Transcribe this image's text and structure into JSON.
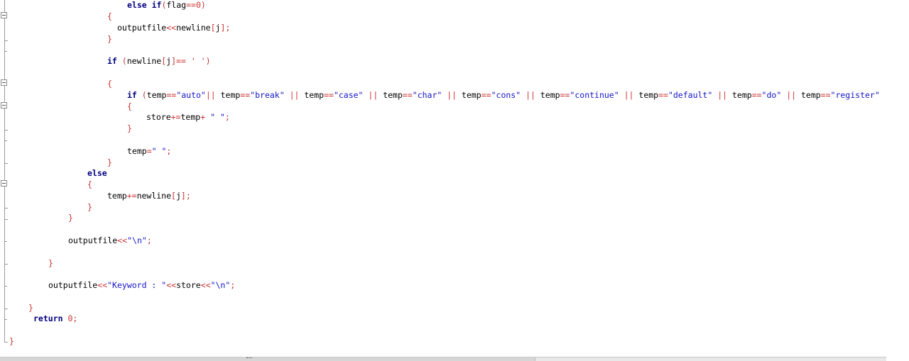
{
  "editor": {
    "colors": {
      "keyword": "#000080",
      "identifier": "#000000",
      "operator": "#cc3333",
      "string": "#1515c8",
      "background": "#ffffff"
    },
    "lines": [
      [
        [
          "kw",
          "else if"
        ],
        [
          "op",
          "("
        ],
        [
          "id",
          "flag"
        ],
        [
          "op",
          "=="
        ],
        [
          "num",
          "0"
        ],
        [
          "op",
          ")"
        ]
      ],
      [
        [
          "op",
          "{"
        ]
      ],
      [
        [
          "id",
          "outputfile"
        ],
        [
          "op",
          "<<"
        ],
        [
          "id",
          "newline"
        ],
        [
          "op",
          "["
        ],
        [
          "id",
          "j"
        ],
        [
          "op",
          "];"
        ]
      ],
      [
        [
          "op",
          "}"
        ]
      ],
      [
        [
          "kw",
          "if"
        ],
        [
          "id",
          " "
        ],
        [
          "op",
          "("
        ],
        [
          "id",
          "newline"
        ],
        [
          "op",
          "["
        ],
        [
          "id",
          "j"
        ],
        [
          "op",
          "]=="
        ],
        [
          "id",
          " "
        ],
        [
          "ch",
          "' '"
        ],
        [
          "op",
          ")"
        ]
      ],
      [
        [
          "op",
          "{"
        ]
      ],
      [
        [
          "kw",
          "if"
        ],
        [
          "id",
          " "
        ],
        [
          "op",
          "("
        ],
        [
          "id",
          "temp"
        ],
        [
          "op",
          "=="
        ],
        [
          "str",
          "\"auto\""
        ],
        [
          "op",
          "||"
        ],
        [
          "id",
          " temp"
        ],
        [
          "op",
          "=="
        ],
        [
          "str",
          "\"break\""
        ],
        [
          "id",
          " "
        ],
        [
          "op",
          "||"
        ],
        [
          "id",
          " temp"
        ],
        [
          "op",
          "=="
        ],
        [
          "str",
          "\"case\""
        ],
        [
          "id",
          " "
        ],
        [
          "op",
          "||"
        ],
        [
          "id",
          " temp"
        ],
        [
          "op",
          "=="
        ],
        [
          "str",
          "\"char\""
        ],
        [
          "id",
          " "
        ],
        [
          "op",
          "||"
        ],
        [
          "id",
          " temp"
        ],
        [
          "op",
          "=="
        ],
        [
          "str",
          "\"cons\""
        ],
        [
          "id",
          " "
        ],
        [
          "op",
          "||"
        ],
        [
          "id",
          " temp"
        ],
        [
          "op",
          "=="
        ],
        [
          "str",
          "\"continue\""
        ],
        [
          "id",
          " "
        ],
        [
          "op",
          "||"
        ],
        [
          "id",
          " temp"
        ],
        [
          "op",
          "=="
        ],
        [
          "str",
          "\"default\""
        ],
        [
          "id",
          " "
        ],
        [
          "op",
          "||"
        ],
        [
          "id",
          " temp"
        ],
        [
          "op",
          "=="
        ],
        [
          "str",
          "\"do\""
        ],
        [
          "id",
          " "
        ],
        [
          "op",
          "||"
        ],
        [
          "id",
          " temp"
        ],
        [
          "op",
          "=="
        ],
        [
          "str",
          "\"register\""
        ]
      ],
      [
        [
          "op",
          "{"
        ]
      ],
      [
        [
          "id",
          "store"
        ],
        [
          "op",
          "+="
        ],
        [
          "id",
          "temp"
        ],
        [
          "op",
          "+"
        ],
        [
          "id",
          " "
        ],
        [
          "str",
          "\" \""
        ],
        [
          "op",
          ";"
        ]
      ],
      [
        [
          "op",
          "}"
        ]
      ],
      [
        [
          "id",
          "temp"
        ],
        [
          "op",
          "="
        ],
        [
          "str",
          "\" \""
        ],
        [
          "op",
          ";"
        ]
      ],
      [
        [
          "op",
          "}"
        ]
      ],
      [
        [
          "kw",
          "else"
        ]
      ],
      [
        [
          "op",
          "{"
        ]
      ],
      [
        [
          "id",
          "temp"
        ],
        [
          "op",
          "+="
        ],
        [
          "id",
          "newline"
        ],
        [
          "op",
          "["
        ],
        [
          "id",
          "j"
        ],
        [
          "op",
          "];"
        ]
      ],
      [
        [
          "op",
          "}"
        ]
      ],
      [
        [
          "op",
          "}"
        ]
      ],
      [
        [
          "id",
          "outputfile"
        ],
        [
          "op",
          "<<"
        ],
        [
          "str",
          "\"\\n\""
        ],
        [
          "op",
          ";"
        ]
      ],
      [
        [
          "op",
          "}"
        ]
      ],
      [
        [
          "id",
          "outputfile"
        ],
        [
          "op",
          "<<"
        ],
        [
          "str",
          "\"Keyword : \""
        ],
        [
          "op",
          "<<"
        ],
        [
          "id",
          "store"
        ],
        [
          "op",
          "<<"
        ],
        [
          "str",
          "\"\\n\""
        ],
        [
          "op",
          ";"
        ]
      ],
      [
        [
          "op",
          "}"
        ]
      ],
      [
        [
          "kw",
          "return"
        ],
        [
          "id",
          " "
        ],
        [
          "num",
          "0"
        ],
        [
          "op",
          ";"
        ]
      ],
      [
        [
          "op",
          "}"
        ]
      ]
    ]
  }
}
